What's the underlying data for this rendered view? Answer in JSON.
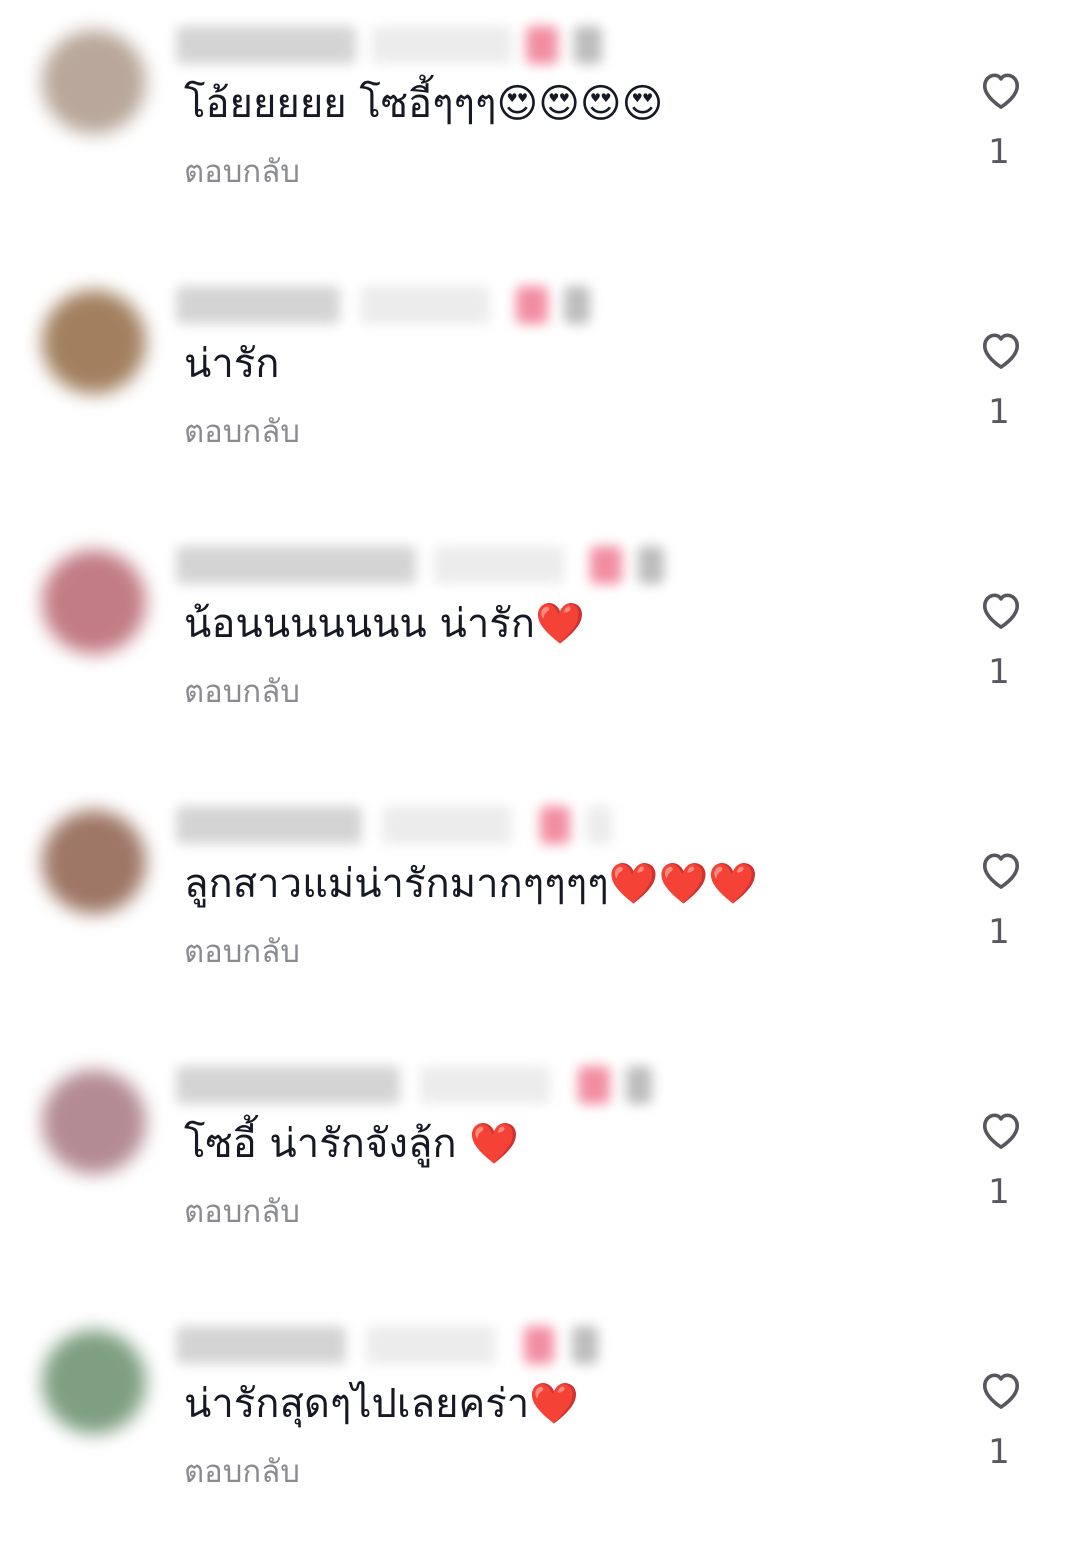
{
  "comments": [
    {
      "text": "โอ้ยยยยย โซอี้ๆๆๆ😍😍😍😍",
      "reply_label": "ตอบกลับ",
      "like_count": "1",
      "avatar_color": "#b8a79a"
    },
    {
      "text": "น่ารัก",
      "reply_label": "ตอบกลับ",
      "like_count": "1",
      "avatar_color": "#a2805f"
    },
    {
      "text": "น้อนนนนนนน น่ารัก❤️",
      "reply_label": "ตอบกลับ",
      "like_count": "1",
      "avatar_color": "#c27c85"
    },
    {
      "text": "ลูกสาวแม่น่ารักมากๆๆๆๆ❤️❤️❤️",
      "reply_label": "ตอบกลับ",
      "like_count": "1",
      "avatar_color": "#9e7766"
    },
    {
      "text": "โซอี้ น่ารักจังลู้ก ❤️",
      "reply_label": "ตอบกลับ",
      "like_count": "1",
      "avatar_color": "#b38b93"
    },
    {
      "text": "น่ารักสุดๆไปเลยคร่า❤️",
      "reply_label": "ตอบกลับ",
      "like_count": "1",
      "avatar_color": "#7f9f82"
    }
  ],
  "colors": {
    "text": "#161823",
    "secondary": "#8a8b91",
    "like_icon": "#57585f",
    "background": "#ffffff"
  },
  "icons": {
    "like": "heart-outline-icon"
  }
}
